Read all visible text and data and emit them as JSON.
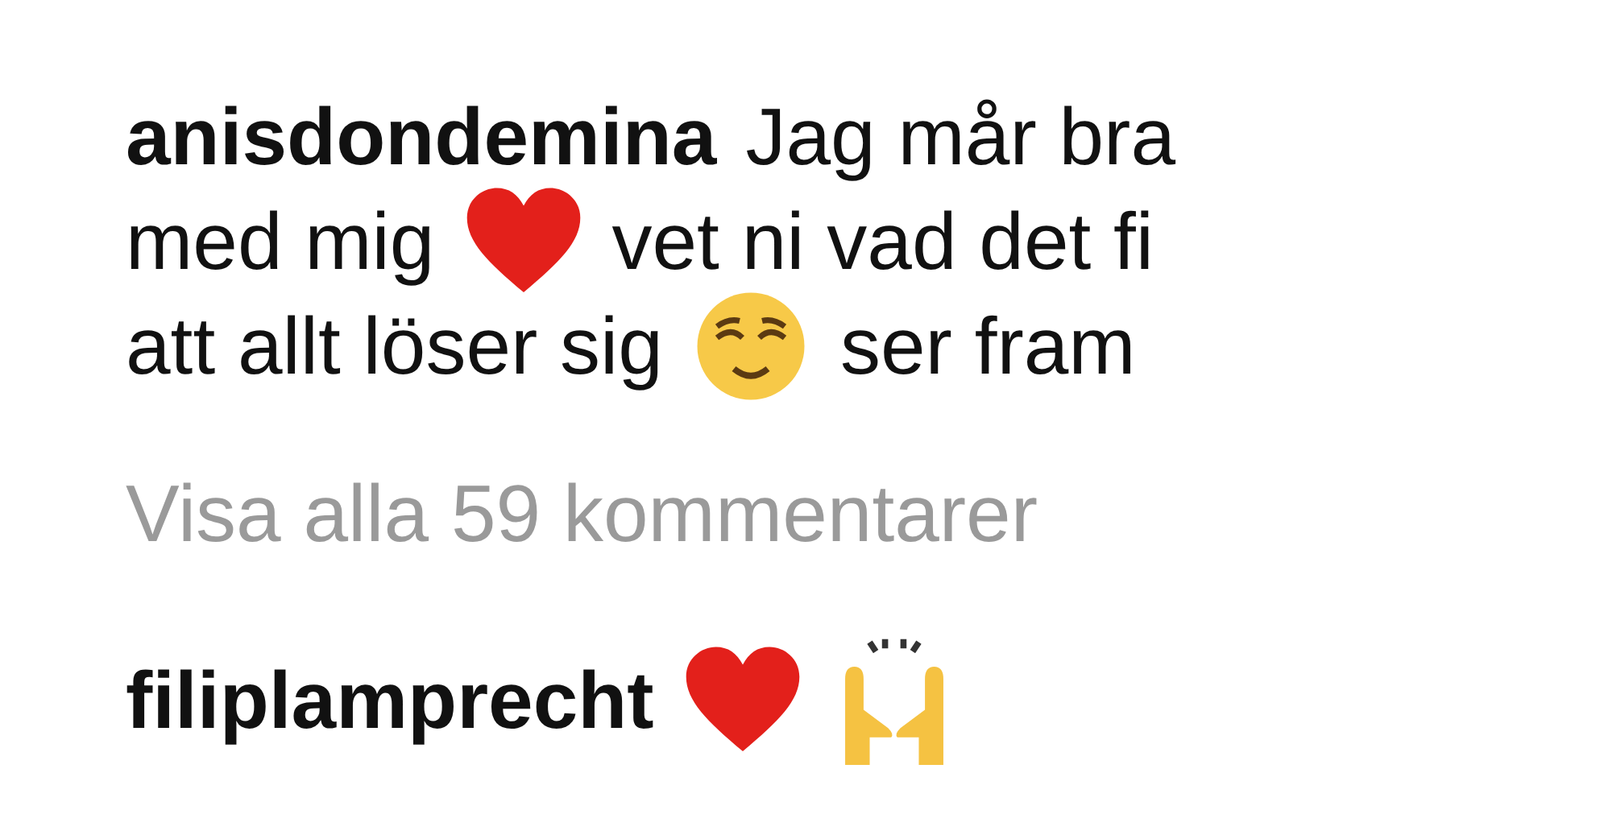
{
  "caption_lines": [
    [
      {
        "kind": "username",
        "text": "anisdondemina"
      },
      {
        "kind": "text",
        "text": "Jag mår bra"
      }
    ],
    [
      {
        "kind": "text",
        "text": "med mig"
      },
      {
        "kind": "heart"
      },
      {
        "kind": "text",
        "text": "vet ni vad det fi"
      }
    ],
    [
      {
        "kind": "text",
        "text": "att allt löser sig"
      },
      {
        "kind": "relieved"
      },
      {
        "kind": "text",
        "text": "ser fram"
      }
    ]
  ],
  "view_all": "Visa alla 59 kommentarer",
  "comment": [
    {
      "kind": "username",
      "text": "filiplamprecht"
    },
    {
      "kind": "heart"
    },
    {
      "kind": "hands"
    }
  ]
}
